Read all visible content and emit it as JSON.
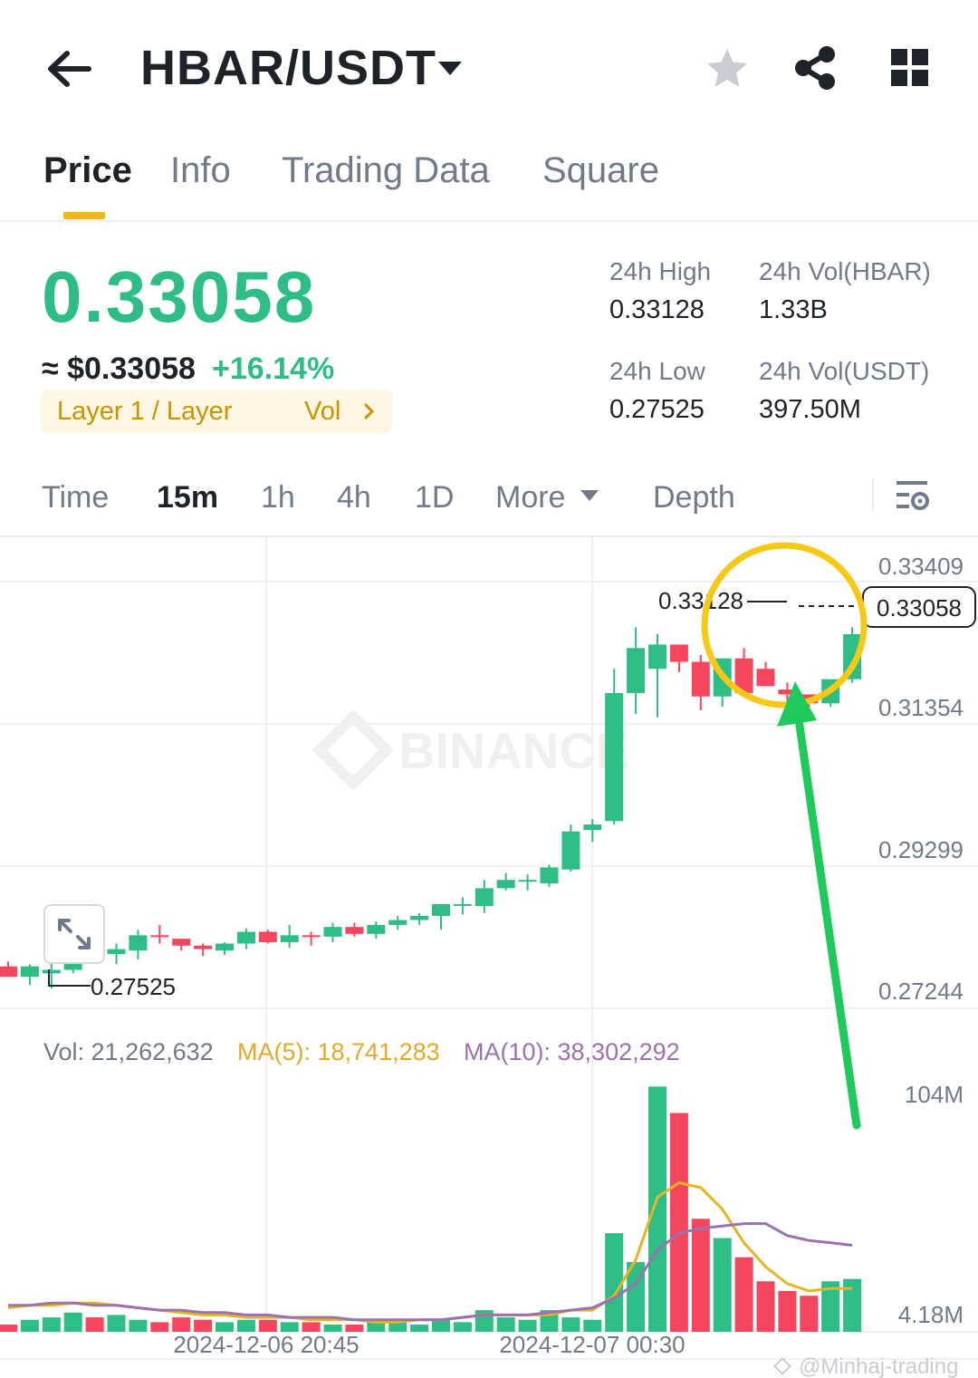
{
  "header": {
    "pair": "HBAR/USDT",
    "icons": [
      "back-arrow-icon",
      "caret-down-icon",
      "star-icon",
      "share-icon",
      "grid-icon"
    ]
  },
  "tabs": [
    "Price",
    "Info",
    "Trading Data",
    "Square"
  ],
  "active_tab": "Price",
  "price": {
    "last": "0.33058",
    "approx_usd": "≈ $0.33058",
    "change_pct": "+16.14%",
    "tag_category": "Layer 1 / Layer",
    "tag_vol": "Vol",
    "high_label": "24h High",
    "high_value": "0.33128",
    "low_label": "24h Low",
    "low_value": "0.27525",
    "vol_base_label": "24h Vol(HBAR)",
    "vol_base_value": "1.33B",
    "vol_quote_label": "24h Vol(USDT)",
    "vol_quote_value": "397.50M"
  },
  "intervals": [
    "Time",
    "15m",
    "1h",
    "4h",
    "1D",
    "More",
    "Depth"
  ],
  "active_interval": "15m",
  "volume_info": {
    "vol": "Vol: 21,262,632",
    "ma5": "MA(5): 18,741,283",
    "ma10": "MA(10): 38,302,292"
  },
  "colors": {
    "up": "#2ebd85",
    "down": "#f6465d",
    "accent": "#f0b90b",
    "ma5": "#e6b422",
    "ma10": "#9b72b0",
    "annotation_arrow": "#22c55e"
  },
  "watermark": "BINANCE",
  "credit": "@Minhaj-trading",
  "chart_data": {
    "type": "candlestick",
    "price_axis": {
      "ticks": [
        "0.33409",
        "0.31354",
        "0.29299",
        "0.27244"
      ],
      "ylim": [
        0.2705,
        0.3355
      ]
    },
    "current_price_label": "0.33058",
    "high_marker": "0.33128",
    "low_marker": "0.27525",
    "x_ticks": [
      "2024-12-06 20:45",
      "2024-12-07 00:30"
    ],
    "volume_axis": {
      "ticks": [
        "104M",
        "4.18M"
      ]
    },
    "candles": [
      {
        "o": 0.2785,
        "h": 0.2792,
        "l": 0.277,
        "c": 0.277
      },
      {
        "o": 0.277,
        "h": 0.2788,
        "l": 0.2758,
        "c": 0.2785
      },
      {
        "o": 0.2775,
        "h": 0.279,
        "l": 0.2753,
        "c": 0.278
      },
      {
        "o": 0.278,
        "h": 0.2818,
        "l": 0.2775,
        "c": 0.281
      },
      {
        "o": 0.281,
        "h": 0.281,
        "l": 0.2795,
        "c": 0.2805
      },
      {
        "o": 0.2803,
        "h": 0.2818,
        "l": 0.2788,
        "c": 0.281
      },
      {
        "o": 0.2808,
        "h": 0.2838,
        "l": 0.2795,
        "c": 0.283
      },
      {
        "o": 0.283,
        "h": 0.2845,
        "l": 0.2818,
        "c": 0.2828
      },
      {
        "o": 0.2825,
        "h": 0.2825,
        "l": 0.2808,
        "c": 0.2815
      },
      {
        "o": 0.2815,
        "h": 0.2818,
        "l": 0.28,
        "c": 0.281
      },
      {
        "o": 0.2808,
        "h": 0.282,
        "l": 0.2802,
        "c": 0.2818
      },
      {
        "o": 0.2818,
        "h": 0.284,
        "l": 0.281,
        "c": 0.2835
      },
      {
        "o": 0.2835,
        "h": 0.2838,
        "l": 0.2818,
        "c": 0.282
      },
      {
        "o": 0.282,
        "h": 0.2845,
        "l": 0.2812,
        "c": 0.283
      },
      {
        "o": 0.283,
        "h": 0.2835,
        "l": 0.2815,
        "c": 0.2828
      },
      {
        "o": 0.2828,
        "h": 0.2848,
        "l": 0.282,
        "c": 0.2842
      },
      {
        "o": 0.2842,
        "h": 0.2848,
        "l": 0.2828,
        "c": 0.2832
      },
      {
        "o": 0.2832,
        "h": 0.285,
        "l": 0.2825,
        "c": 0.2845
      },
      {
        "o": 0.2845,
        "h": 0.2858,
        "l": 0.2838,
        "c": 0.2852
      },
      {
        "o": 0.2852,
        "h": 0.2862,
        "l": 0.2845,
        "c": 0.2858
      },
      {
        "o": 0.2858,
        "h": 0.2875,
        "l": 0.2838,
        "c": 0.2875
      },
      {
        "o": 0.2875,
        "h": 0.2885,
        "l": 0.286,
        "c": 0.2875
      },
      {
        "o": 0.2872,
        "h": 0.291,
        "l": 0.2862,
        "c": 0.2898
      },
      {
        "o": 0.2898,
        "h": 0.292,
        "l": 0.2895,
        "c": 0.291
      },
      {
        "o": 0.291,
        "h": 0.2918,
        "l": 0.2895,
        "c": 0.291
      },
      {
        "o": 0.2905,
        "h": 0.2932,
        "l": 0.29,
        "c": 0.2928
      },
      {
        "o": 0.2925,
        "h": 0.299,
        "l": 0.2922,
        "c": 0.298
      },
      {
        "o": 0.2982,
        "h": 0.2998,
        "l": 0.2965,
        "c": 0.299
      },
      {
        "o": 0.2995,
        "h": 0.3215,
        "l": 0.299,
        "c": 0.318
      },
      {
        "o": 0.318,
        "h": 0.3275,
        "l": 0.315,
        "c": 0.3245
      },
      {
        "o": 0.3215,
        "h": 0.3265,
        "l": 0.3145,
        "c": 0.325
      },
      {
        "o": 0.325,
        "h": 0.325,
        "l": 0.321,
        "c": 0.3225
      },
      {
        "o": 0.3225,
        "h": 0.3235,
        "l": 0.3155,
        "c": 0.3175
      },
      {
        "o": 0.3175,
        "h": 0.323,
        "l": 0.316,
        "c": 0.323
      },
      {
        "o": 0.323,
        "h": 0.3245,
        "l": 0.3175,
        "c": 0.318
      },
      {
        "o": 0.3215,
        "h": 0.3225,
        "l": 0.319,
        "c": 0.319
      },
      {
        "o": 0.3185,
        "h": 0.3195,
        "l": 0.3165,
        "c": 0.3178
      },
      {
        "o": 0.3178,
        "h": 0.3178,
        "l": 0.3148,
        "c": 0.3165
      },
      {
        "o": 0.3165,
        "h": 0.32,
        "l": 0.316,
        "c": 0.32
      },
      {
        "o": 0.32,
        "h": 0.3275,
        "l": 0.3195,
        "c": 0.3265
      }
    ],
    "volumes_m": [
      3,
      5,
      6,
      8,
      6,
      7,
      5,
      4,
      6,
      5,
      4,
      5,
      5,
      4,
      4,
      3,
      3,
      4,
      5,
      3,
      5,
      4,
      9,
      6,
      5,
      9,
      6,
      5,
      41,
      29,
      102,
      91,
      47,
      39,
      31,
      21,
      17,
      15,
      21,
      22
    ],
    "ma5_m": [
      10,
      11,
      11,
      12,
      12,
      11,
      10,
      9,
      8,
      7,
      7,
      6,
      6,
      6,
      5,
      5,
      5,
      4,
      4,
      5,
      5,
      6,
      7,
      7,
      7,
      7,
      9,
      9,
      15,
      30,
      56,
      62,
      60,
      51,
      37,
      27,
      20,
      17,
      18,
      18
    ],
    "ma10_m": [
      11,
      11,
      12,
      12,
      11,
      11,
      10,
      9,
      9,
      8,
      8,
      7,
      7,
      6,
      6,
      6,
      5,
      5,
      5,
      5,
      5,
      6,
      7,
      7,
      7,
      8,
      9,
      10,
      14,
      20,
      34,
      41,
      43,
      44,
      45,
      45,
      40,
      38,
      37,
      36
    ]
  }
}
